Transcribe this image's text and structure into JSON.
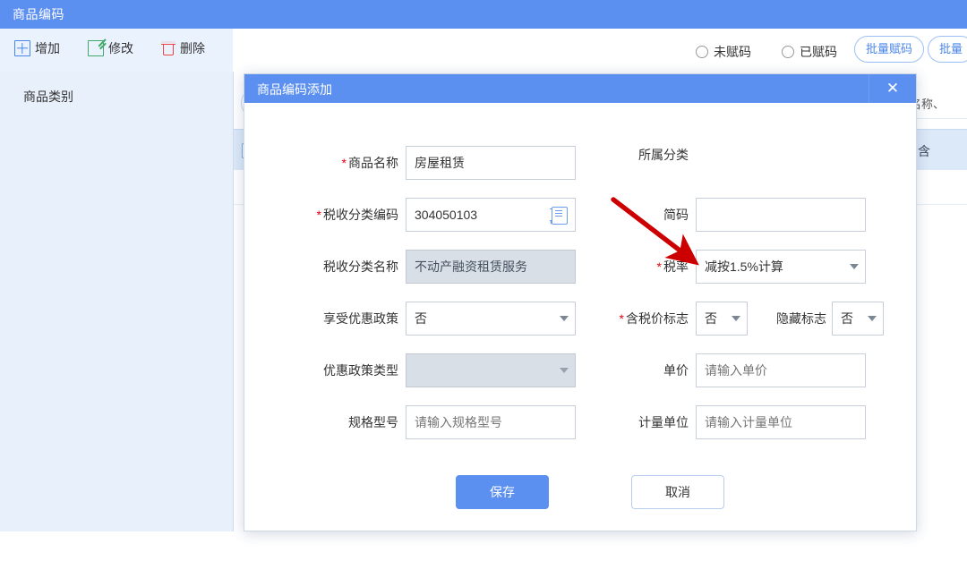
{
  "app": {
    "title": "商品编码",
    "toolbar": [
      {
        "label": "增加",
        "icon": "plus-box-icon"
      },
      {
        "label": "修改",
        "icon": "edit-pencil-icon"
      },
      {
        "label": "删除",
        "icon": "trash-icon"
      }
    ],
    "sidebar": {
      "item": "商品类别"
    },
    "filters": {
      "radio_unassigned": "未赋码",
      "radio_assigned": "已赋码",
      "batch_button_1": "批量赋码",
      "batch_button_2": "批量",
      "search_placeholder_partial": "名称、",
      "table_header_partial": "含"
    }
  },
  "dialog": {
    "title": "商品编码添加",
    "close_icon": "close-icon",
    "left": {
      "product_name": {
        "label": "商品名称",
        "required": true,
        "value": "房屋租赁"
      },
      "tax_class_code": {
        "label": "税收分类编码",
        "required": true,
        "value": "304050103",
        "icon": "book-list-icon"
      },
      "tax_class_name": {
        "label": "税收分类名称",
        "required": false,
        "value": "不动产融资租赁服务",
        "disabled": true
      },
      "preferential_policy": {
        "label": "享受优惠政策",
        "required": false,
        "value": "否",
        "type": "select"
      },
      "policy_type": {
        "label": "优惠政策类型",
        "required": false,
        "value": "",
        "type": "select",
        "disabled": true
      },
      "spec_model": {
        "label": "规格型号",
        "required": false,
        "value": "",
        "placeholder": "请输入规格型号"
      }
    },
    "right": {
      "category_label": {
        "label": "所属分类"
      },
      "short_code": {
        "label": "简码",
        "required": false,
        "value": ""
      },
      "tax_rate": {
        "label": "税率",
        "required": true,
        "value": "减按1.5%计算",
        "type": "select"
      },
      "tax_included_flag": {
        "label": "含税价标志",
        "required": true,
        "value": "否",
        "type": "select"
      },
      "hidden_flag": {
        "label": "隐藏标志",
        "required": false,
        "value": "否",
        "type": "select"
      },
      "unit_price": {
        "label": "单价",
        "required": false,
        "value": "",
        "placeholder": "请输入单价"
      },
      "measure_unit": {
        "label": "计量单位",
        "required": false,
        "value": "",
        "placeholder": "请输入计量单位"
      }
    },
    "actions": {
      "save": "保存",
      "cancel": "取消"
    }
  },
  "annotation": {
    "type": "red-arrow",
    "points_to": "tax_rate"
  },
  "colors": {
    "brand_blue": "#5b8ff0",
    "sidebar_bg": "#e8f1fb",
    "toolbar_bg": "#eaf2fd",
    "required_red": "#e60012",
    "arrow_red": "#cc0000",
    "disabled_bg": "#d9dfe6"
  }
}
